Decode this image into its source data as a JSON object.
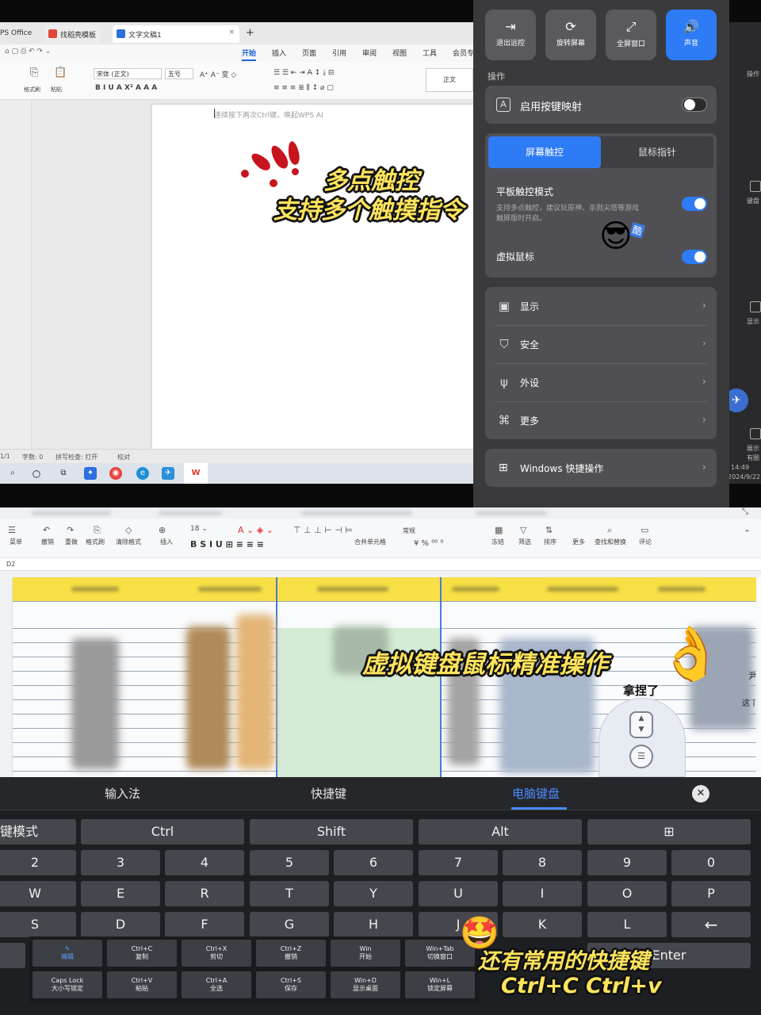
{
  "wps": {
    "tabs": [
      {
        "label": "PS Office"
      },
      {
        "label": "找稻壳模板"
      },
      {
        "label": "文字文稿1"
      }
    ],
    "new_tab": "+",
    "menu": [
      "开始",
      "插入",
      "页面",
      "引用",
      "审阅",
      "视图",
      "工具",
      "会员专"
    ],
    "ribbon": {
      "format_brush": "格式刷",
      "paste": "粘贴",
      "font": "宋体 (正文)",
      "size": "五号",
      "style_normal": "正文"
    },
    "ai_hint": "连续按下两次Ctrl键，唤起WPS AI",
    "status": [
      "1/1",
      "字数: 0",
      "拼写检查: 打开",
      "校对"
    ]
  },
  "overlay_top": {
    "line1": "多点触控",
    "line2": "支持多个触摸指令"
  },
  "panel": {
    "buttons": [
      {
        "label": "退出远控",
        "icon": "exit-icon"
      },
      {
        "label": "旋转屏幕",
        "icon": "rotate-icon"
      },
      {
        "label": "全屏窗口",
        "icon": "fullscreen-icon"
      },
      {
        "label": "声音",
        "icon": "sound-icon"
      }
    ],
    "section_ops": "操作",
    "key_mapping": "启用按键映射",
    "mode_tabs": [
      "屏幕触控",
      "鼠标指针"
    ],
    "tablet_mode_title": "平板触控模式",
    "tablet_mode_desc1": "支持多点触控，建议玩原神、杀戮尖塔等游戏",
    "tablet_mode_desc2": "触屏版时开启。",
    "virtual_mouse": "虚拟鼠标",
    "cool_sticker": "酷",
    "nav": [
      {
        "label": "显示",
        "icon": "display-icon"
      },
      {
        "label": "安全",
        "icon": "shield-icon"
      },
      {
        "label": "外设",
        "icon": "usb-icon"
      },
      {
        "label": "更多",
        "icon": "grid-icon"
      }
    ],
    "windows_shortcuts": "Windows 快捷操作",
    "edge_labels": [
      "操作",
      "键盘",
      "显示",
      "展示",
      "有圈"
    ],
    "clock": "14:49",
    "date": "2024/9/22"
  },
  "sheet": {
    "cell_ref": "D2",
    "toolbar": [
      "菜单",
      "撤销",
      "重做",
      "格式刷",
      "清除格式",
      "插入",
      "合并单元格",
      "冻结",
      "筛选",
      "排序",
      "更多",
      "查找和替换",
      "评论"
    ],
    "format_label": "常规",
    "side_text": [
      "尹",
      "这丨"
    ]
  },
  "overlay_bottom": {
    "caption": "虚拟键盘鼠标精准操作",
    "pinched": "拿捏了",
    "shortcut_line1": "还有常用的快捷键",
    "shortcut_line2": "Ctrl+C Ctrl+v"
  },
  "keyboard": {
    "tabs": [
      "输入法",
      "快捷键",
      "电脑键盘"
    ],
    "active_tab": "电脑键盘",
    "close": "✕",
    "mod_row": [
      "键模式",
      "Ctrl",
      "Shift",
      "Alt",
      "⊞"
    ],
    "num_row": [
      "2",
      "3",
      "4",
      "5",
      "6",
      "7",
      "8",
      "9",
      "0"
    ],
    "row_q": [
      "W",
      "E",
      "R",
      "T",
      "Y",
      "U",
      "I",
      "O",
      "P"
    ],
    "row_a": [
      "S",
      "D",
      "F",
      "G",
      "H",
      "J",
      "K",
      "L",
      "←"
    ],
    "enter": "Enter"
  },
  "shortcuts": [
    {
      "top": "✎",
      "bottom": "编辑"
    },
    {
      "top": "Ctrl+C",
      "bottom": "复制"
    },
    {
      "top": "Ctrl+X",
      "bottom": "剪切"
    },
    {
      "top": "Ctrl+Z",
      "bottom": "撤销"
    },
    {
      "top": "Win",
      "bottom": "开始"
    },
    {
      "top": "Win+Tab",
      "bottom": "切换窗口"
    },
    {
      "top": "Caps Lock",
      "bottom": "大小写锁定"
    },
    {
      "top": "Ctrl+V",
      "bottom": "粘贴"
    },
    {
      "top": "Ctrl+A",
      "bottom": "全选"
    },
    {
      "top": "Ctrl+S",
      "bottom": "保存"
    },
    {
      "top": "Win+D",
      "bottom": "显示桌面"
    },
    {
      "top": "Win+L",
      "bottom": "锁定屏幕"
    }
  ]
}
